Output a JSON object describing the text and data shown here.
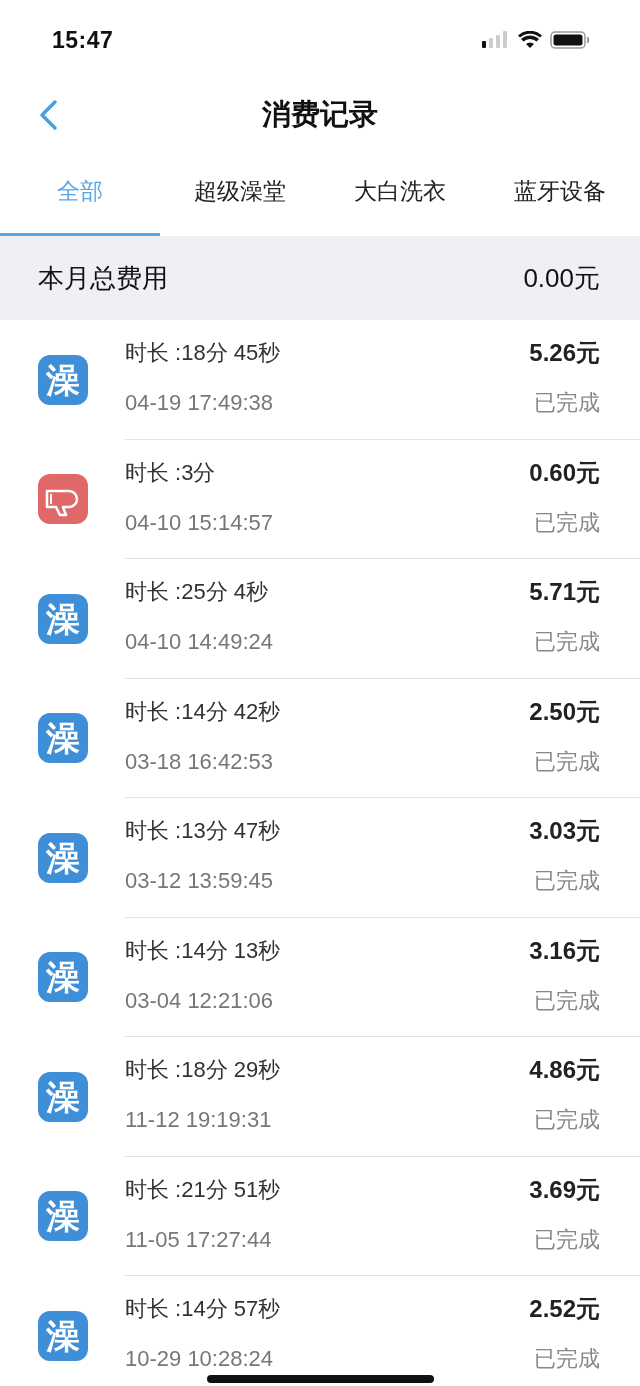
{
  "status_bar": {
    "time": "15:47"
  },
  "nav": {
    "title": "消费记录"
  },
  "tabs": [
    {
      "label": "全部",
      "selected": true
    },
    {
      "label": "超级澡堂",
      "selected": false
    },
    {
      "label": "大白洗衣",
      "selected": false
    },
    {
      "label": "蓝牙设备",
      "selected": false
    }
  ],
  "summary": {
    "label": "本月总费用",
    "amount": "0.00元"
  },
  "records": [
    {
      "kind": "bath",
      "icon_text": "澡",
      "duration": "时长 :18分 45秒",
      "time": "04-19 17:49:38",
      "amount": "5.26元",
      "status": "已完成"
    },
    {
      "kind": "dryer",
      "duration": "时长 :3分",
      "time": "04-10 15:14:57",
      "amount": "0.60元",
      "status": "已完成"
    },
    {
      "kind": "bath",
      "icon_text": "澡",
      "duration": "时长 :25分 4秒",
      "time": "04-10 14:49:24",
      "amount": "5.71元",
      "status": "已完成"
    },
    {
      "kind": "bath",
      "icon_text": "澡",
      "duration": "时长 :14分 42秒",
      "time": "03-18 16:42:53",
      "amount": "2.50元",
      "status": "已完成"
    },
    {
      "kind": "bath",
      "icon_text": "澡",
      "duration": "时长 :13分 47秒",
      "time": "03-12 13:59:45",
      "amount": "3.03元",
      "status": "已完成"
    },
    {
      "kind": "bath",
      "icon_text": "澡",
      "duration": "时长 :14分 13秒",
      "time": "03-04 12:21:06",
      "amount": "3.16元",
      "status": "已完成"
    },
    {
      "kind": "bath",
      "icon_text": "澡",
      "duration": "时长 :18分 29秒",
      "time": "11-12 19:19:31",
      "amount": "4.86元",
      "status": "已完成"
    },
    {
      "kind": "bath",
      "icon_text": "澡",
      "duration": "时长 :21分 51秒",
      "time": "11-05 17:27:44",
      "amount": "3.69元",
      "status": "已完成"
    },
    {
      "kind": "bath",
      "icon_text": "澡",
      "duration": "时长 :14分 57秒",
      "time": "10-29 10:28:24",
      "amount": "2.52元",
      "status": "已完成"
    }
  ]
}
